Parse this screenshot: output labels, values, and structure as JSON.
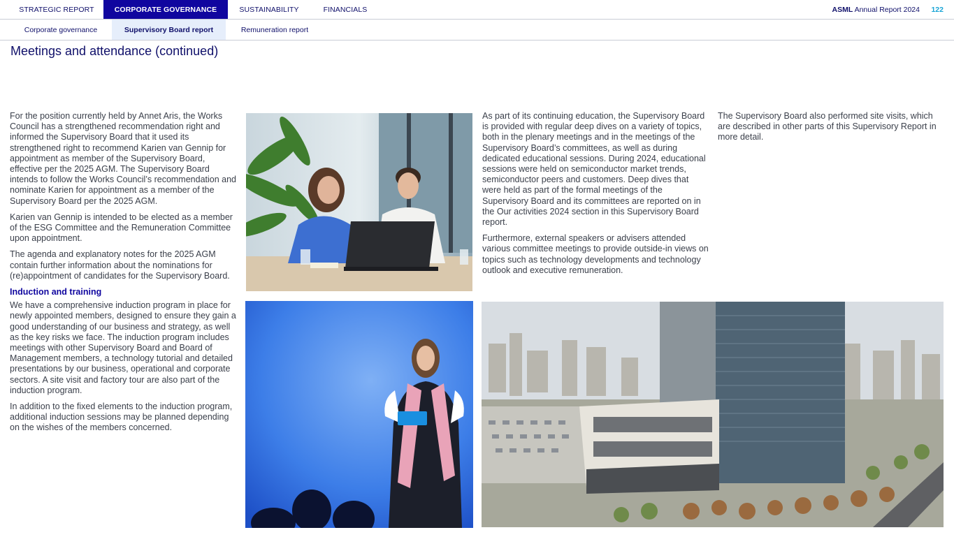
{
  "nav": {
    "tabs": [
      {
        "label": "STRATEGIC REPORT"
      },
      {
        "label": "CORPORATE GOVERNANCE"
      },
      {
        "label": "SUSTAINABILITY"
      },
      {
        "label": "FINANCIALS"
      }
    ],
    "brand_bold": "ASML",
    "brand_rest": " Annual Report 2024",
    "page_number": "122"
  },
  "subnav": {
    "items": [
      {
        "label": "Corporate governance"
      },
      {
        "label": "Supervisory Board report"
      },
      {
        "label": "Remuneration report"
      }
    ]
  },
  "page_title": "Meetings and attendance (continued)",
  "col1": {
    "p1": "For the position currently held by Annet Aris, the Works Council has a strengthened recommendation right and informed the Supervisory Board that it used its strengthened right to recommend Karien van Gennip for appointment as member of the Supervisory Board, effective per the 2025 AGM. The Supervisory Board intends to follow the Works Council’s recommendation and nominate Karien for appointment as a member of the Supervisory Board per the 2025 AGM.",
    "p2": "Karien van Gennip is intended to be elected as a member of the ESG Committee and the Remuneration Committee upon appointment.",
    "p3": "The agenda and explanatory notes for the 2025 AGM contain further information about the nominations for (re)appointment of candidates for the Supervisory Board.",
    "heading": "Induction and training",
    "p4": "We have a comprehensive induction program in place for newly appointed members, designed to ensure they gain a good understanding of our business and strategy, as well as the key risks we face. The induction program includes meetings with other Supervisory Board and Board of Management members, a technology tutorial and detailed presentations by our business, operational and corporate sectors. A site visit and factory tour are also part of the induction program.",
    "p5": "In addition to the fixed elements to the induction program, additional induction sessions may be planned depending on the wishes of the members concerned."
  },
  "col3": {
    "p1": "As part of its continuing education, the Supervisory Board is provided with regular deep dives on a variety of topics, both in the plenary meetings and in the meetings of the Supervisory Board’s committees, as well as during dedicated educational sessions. During 2024, educational sessions were held on semiconductor market trends, semiconductor peers and customers. Deep dives that were held as part of the formal meetings of the Supervisory Board and its committees are reported on in the Our activities 2024 section in this Supervisory Board report.",
    "p2": "Furthermore, external speakers or advisers attended various committee meetings to provide outside-in views on topics such as technology developments and technology outlook and executive remuneration."
  },
  "col4": {
    "p1": "The Supervisory Board also performed site visits, which are described in other parts of this Supervisory Report in more detail."
  },
  "colors": {
    "navy": "#10106a",
    "active_tab": "#10069f",
    "accent_blue": "#1aa5d6",
    "sub_active_bg": "#e6eefb"
  }
}
